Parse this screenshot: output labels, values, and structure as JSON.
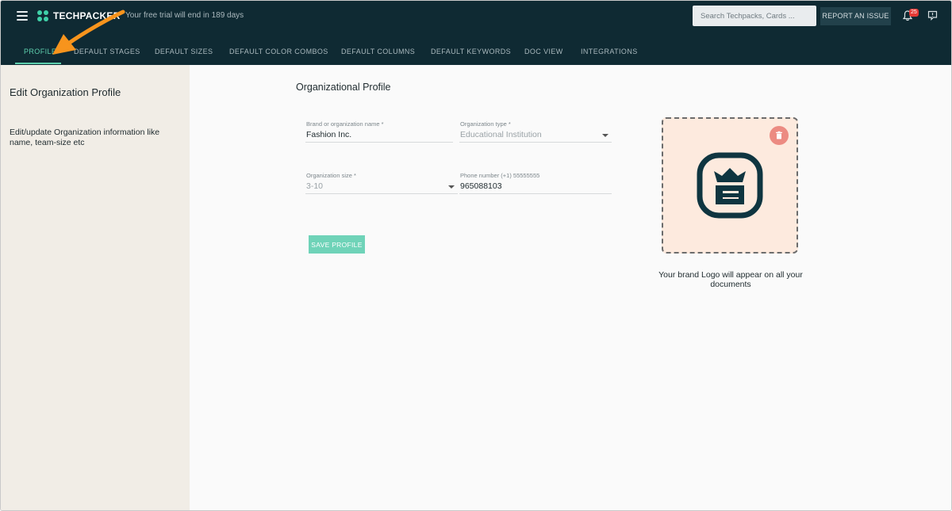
{
  "header": {
    "app_name": "TECHPACKER",
    "trial_notice": "Your free trial will end in 189 days",
    "search_placeholder": "Search Techpacks, Cards ...",
    "report_issue_label": "REPORT AN ISSUE",
    "notification_count": "25"
  },
  "tabs": [
    {
      "label": "PROFILE",
      "active": true
    },
    {
      "label": "DEFAULT STAGES"
    },
    {
      "label": "DEFAULT SIZES"
    },
    {
      "label": "DEFAULT COLOR COMBOS"
    },
    {
      "label": "DEFAULT COLUMNS"
    },
    {
      "label": "DEFAULT KEYWORDS"
    },
    {
      "label": "DOC VIEW"
    },
    {
      "label": "INTEGRATIONS"
    }
  ],
  "sidebar": {
    "title": "Edit Organization Profile",
    "description": "Edit/update Organization information like name, team-size etc"
  },
  "form": {
    "title": "Organizational Profile",
    "brand_name": {
      "label": "Brand or organization name *",
      "value": "Fashion Inc."
    },
    "org_type": {
      "label": "Organization type *",
      "value": "Educational Institution"
    },
    "org_size": {
      "label": "Organization size *",
      "value": "3-10"
    },
    "phone": {
      "label": "Phone number (+1) 55555555",
      "value": "965088103"
    },
    "save_label": "SAVE PROFILE"
  },
  "logo": {
    "caption": "Your brand Logo will appear on all your documents"
  },
  "colors": {
    "header_bg": "#0f2a33",
    "accent": "#5ecfae",
    "sidebar_bg": "#f1ede6",
    "logo_bg": "#fdeade",
    "annotation": "#f7941d"
  }
}
